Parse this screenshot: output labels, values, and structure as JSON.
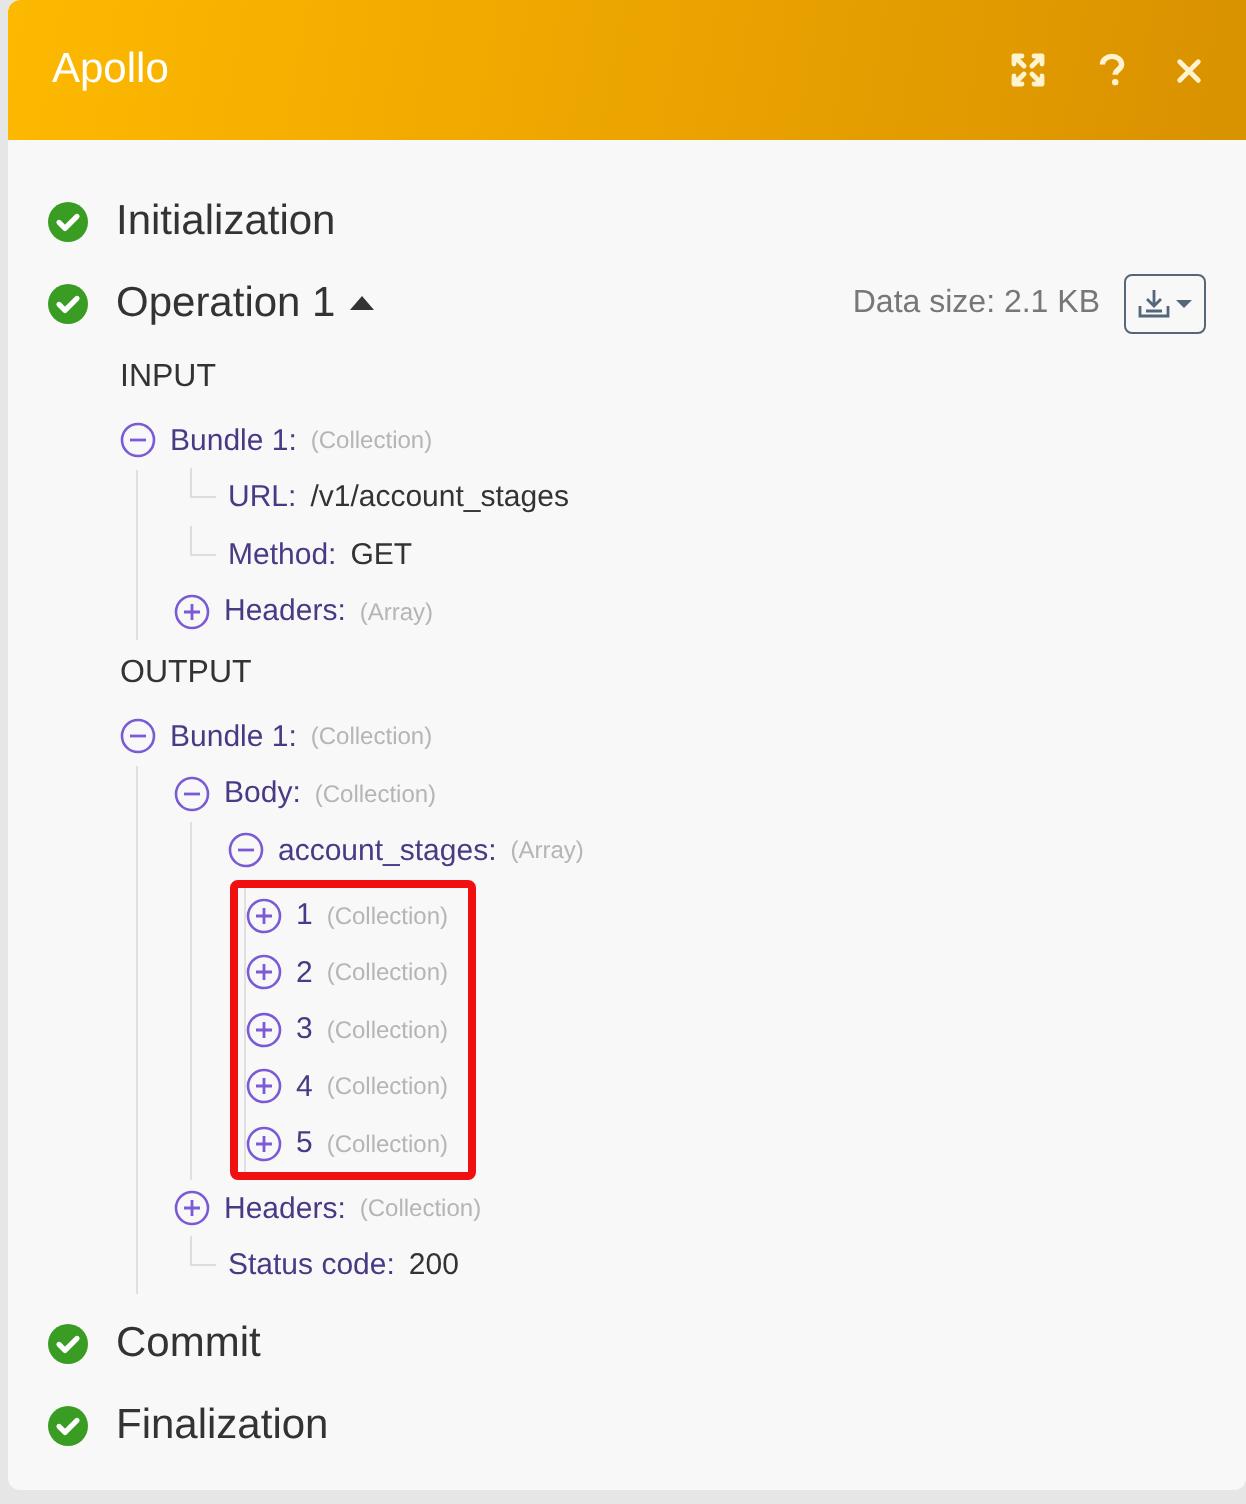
{
  "window": {
    "title": "Apollo"
  },
  "stages": [
    {
      "label": "Initialization",
      "completed": true
    },
    {
      "label": "Operation 1",
      "completed": true,
      "expanded": true,
      "data_size": "Data size: 2.1 KB",
      "sections": [
        {
          "heading": "INPUT",
          "tree": [
            {
              "kind": "branch",
              "label": "Bundle 1:",
              "type": "(Collection)",
              "expanded": true,
              "children": [
                {
                  "kind": "leaf",
                  "label": "URL:",
                  "value": "/v1/account_stages"
                },
                {
                  "kind": "leaf",
                  "label": "Method:",
                  "value": "GET"
                },
                {
                  "kind": "branch",
                  "label": "Headers:",
                  "type": "(Array)",
                  "expanded": false
                }
              ]
            }
          ]
        },
        {
          "heading": "OUTPUT",
          "tree": [
            {
              "kind": "branch",
              "label": "Bundle 1:",
              "type": "(Collection)",
              "expanded": true,
              "children": [
                {
                  "kind": "branch",
                  "label": "Body:",
                  "type": "(Collection)",
                  "expanded": true,
                  "children": [
                    {
                      "kind": "branch",
                      "label": "account_stages:",
                      "type": "(Array)",
                      "expanded": true,
                      "highlight": true,
                      "children": [
                        {
                          "kind": "branch",
                          "label": "1",
                          "type": "(Collection)",
                          "expanded": false
                        },
                        {
                          "kind": "branch",
                          "label": "2",
                          "type": "(Collection)",
                          "expanded": false
                        },
                        {
                          "kind": "branch",
                          "label": "3",
                          "type": "(Collection)",
                          "expanded": false
                        },
                        {
                          "kind": "branch",
                          "label": "4",
                          "type": "(Collection)",
                          "expanded": false
                        },
                        {
                          "kind": "branch",
                          "label": "5",
                          "type": "(Collection)",
                          "expanded": false
                        }
                      ]
                    }
                  ]
                },
                {
                  "kind": "branch",
                  "label": "Headers:",
                  "type": "(Collection)",
                  "expanded": false
                },
                {
                  "kind": "leaf",
                  "label": "Status code:",
                  "value": "200"
                }
              ]
            }
          ]
        }
      ]
    },
    {
      "label": "Commit",
      "completed": true
    },
    {
      "label": "Finalization",
      "completed": true
    }
  ]
}
